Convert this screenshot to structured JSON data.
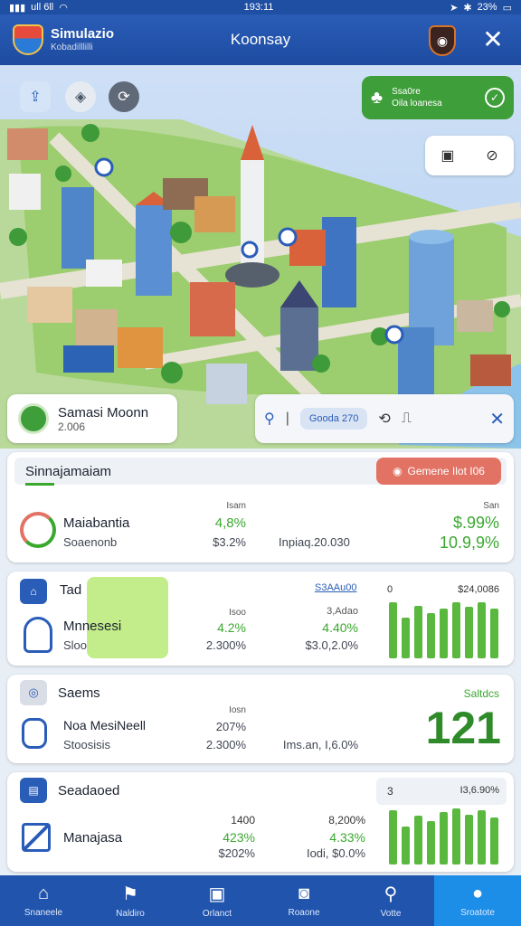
{
  "status": {
    "left": "ull 6ll",
    "time": "193:11",
    "right": "23%"
  },
  "header": {
    "title": "Simulazio",
    "subtitle": "Kobadilllilli",
    "center": "Koonsay"
  },
  "map": {
    "promo": {
      "line1": "Ssa0re",
      "line2": "Oila loanesa"
    },
    "info_card": {
      "title": "Samasi Moonn",
      "value": "2.006"
    },
    "action_chip": "Gooda 270"
  },
  "card1": {
    "title": "Sinnajamaiam",
    "button": "Gemene Ilot I06",
    "row_title": "Maiabantia",
    "row_sub": "Soaenonb",
    "mid_head": "Isam",
    "mid_pct": "4,8%",
    "mid_val": "$3.2%",
    "info": "Inpiaq.20.030",
    "right_head": "San",
    "right_val1": "$.99%",
    "right_val2": "10.9,9%"
  },
  "card2": {
    "title": "Tad",
    "link": "S3AAu00",
    "row_title": "Mnnesesi",
    "row_sub": "Sloo",
    "c1_head": "Isoo",
    "c1_pct": "4.2%",
    "c1_val": "2.300%",
    "c2_head": "3,Adao",
    "c2_pct": "4.40%",
    "c2_val": "$3.0,2.0%",
    "chart_head_left": "0",
    "chart_head_right": "$24,0086",
    "bar_values": [
      62,
      45,
      58,
      50,
      55,
      62,
      57,
      62,
      55
    ]
  },
  "card3": {
    "title": "Saems",
    "label_right": "Saltdcs",
    "row_title": "Noa MesiNeell",
    "row_sub": "Stoosisis",
    "c1_head": "Iosn",
    "c1_val": "207%",
    "c1_sub": "2.300%",
    "info": "Ims.an, I,6.0%",
    "big_number": "121"
  },
  "card4": {
    "title": "Seadaoed",
    "head_left": "3",
    "head_right": "I3,6.90%",
    "row_title": "Manajasa",
    "c1_head": "1400",
    "c1_pct": "423%",
    "c1_val": "$202%",
    "c2_head": "8,200%",
    "c2_pct": "4.33%",
    "c2_val": "Iodi, $0.0%",
    "bar_values": [
      60,
      42,
      54,
      48,
      58,
      62,
      55,
      60,
      52
    ]
  },
  "nav": [
    {
      "label": "Snaneele",
      "icon": "home-icon"
    },
    {
      "label": "Naldiro",
      "icon": "flag-icon"
    },
    {
      "label": "Orlanct",
      "icon": "gallery-icon"
    },
    {
      "label": "Roaone",
      "icon": "camera-icon"
    },
    {
      "label": "Votte",
      "icon": "search-icon"
    },
    {
      "label": "Sroatote",
      "icon": "profile-icon"
    }
  ],
  "colors": {
    "primary": "#2054ad",
    "accent_green": "#3aa82f",
    "alert_red": "#e27264",
    "active_tab": "#1d8ee8"
  }
}
